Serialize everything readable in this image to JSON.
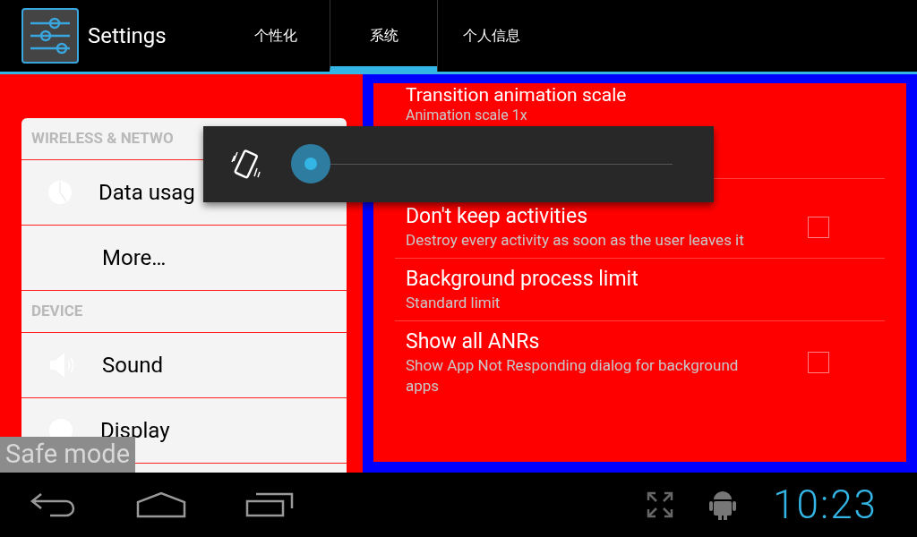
{
  "app_bar": {
    "title": "Settings",
    "tabs": [
      {
        "label": "个性化",
        "selected": false
      },
      {
        "label": "系统",
        "selected": true
      },
      {
        "label": "个人信息",
        "selected": false
      }
    ]
  },
  "sidebar": {
    "groups": [
      {
        "header": "WIRELESS & NETWO",
        "items": [
          {
            "label": "Data usag"
          },
          {
            "label": "More…"
          }
        ]
      },
      {
        "header": "DEVICE",
        "items": [
          {
            "label": "Sound"
          },
          {
            "label": "Display"
          }
        ]
      }
    ]
  },
  "settings": [
    {
      "kind": "plain",
      "title": "Transition animation scale",
      "summary": "Animation scale 1x"
    },
    {
      "kind": "checkbox",
      "title": "Don't keep activities",
      "summary": "Destroy every activity as soon as the user leaves it",
      "checked": false
    },
    {
      "kind": "plain",
      "title": "Background process limit",
      "summary": "Standard limit"
    },
    {
      "kind": "checkbox",
      "title": "Show all ANRs",
      "summary": "Show App Not Responding dialog for background apps",
      "checked": false
    }
  ],
  "volume_panel": {
    "level": 0
  },
  "safe_mode": "Safe mode",
  "nav_bar": {
    "clock": "10:23"
  }
}
